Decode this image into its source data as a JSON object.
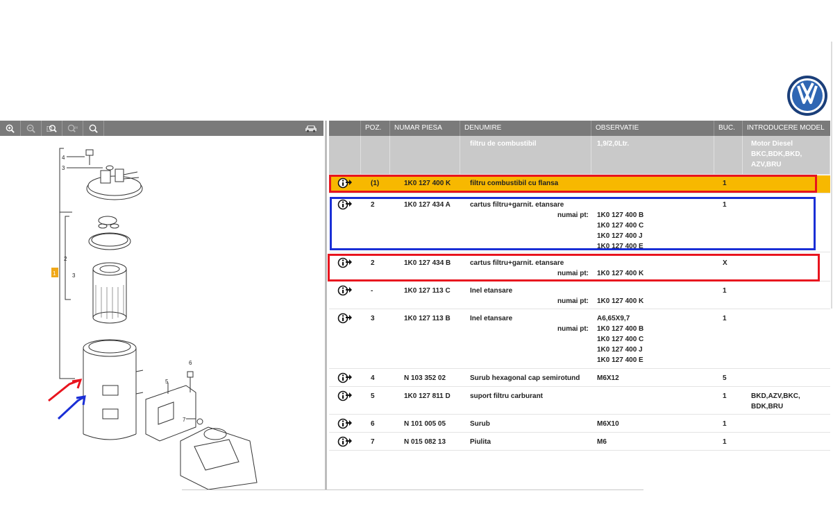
{
  "brand": {
    "logo_icon": "vw-logo-icon"
  },
  "toolbar": {
    "buttons": [
      "zoom-in-icon",
      "zoom-out-icon",
      "zoom-window-icon",
      "zoom-100-icon",
      "search-icon"
    ],
    "car_icon": "car-icon"
  },
  "diagram": {
    "callouts": [
      "4",
      "3",
      "2",
      "3",
      "1",
      "6",
      "5",
      "7"
    ]
  },
  "table": {
    "headers": [
      "",
      "POZ.",
      "NUMAR PIESA",
      "DENUMIRE",
      "OBSERVATIE",
      "BUC.",
      "INTRODUCERE MODEL"
    ],
    "info": {
      "denumire": "filtru de combustibil",
      "observatie": "1,9/2,0Ltr.",
      "introducere": "Motor Diesel BKC,BDK,BKD, AZV,BRU"
    },
    "rows": [
      {
        "poz": "(1)",
        "nr": "1K0 127 400 K",
        "den": "filtru combustibil cu flansa",
        "sub": "",
        "obs": [],
        "buc": "1",
        "intr": ""
      },
      {
        "poz": "2",
        "nr": "1K0 127 434 A",
        "den": "cartus filtru+garnit. etansare",
        "sub": "numai pt:",
        "obs": [
          "1K0 127 400 B",
          "1K0 127 400 C",
          "1K0 127 400 J",
          "1K0 127 400 E"
        ],
        "buc": "1",
        "intr": ""
      },
      {
        "poz": "2",
        "nr": "1K0 127 434 B",
        "den": "cartus filtru+garnit. etansare",
        "sub": "numai pt:",
        "obs": [
          "1K0 127 400 K"
        ],
        "buc": "X",
        "intr": ""
      },
      {
        "poz": "-",
        "nr": "1K0 127 113 C",
        "den": "Inel etansare",
        "sub": "numai pt:",
        "obs": [
          "1K0 127 400 K"
        ],
        "buc": "1",
        "intr": ""
      },
      {
        "poz": "3",
        "nr": "1K0 127 113 B",
        "den": "Inel etansare",
        "sub": "numai pt:",
        "obs": [
          "A6,65X9,7",
          "1K0 127 400 B",
          "1K0 127 400 C",
          "1K0 127 400 J",
          "1K0 127 400 E"
        ],
        "buc": "1",
        "intr": ""
      },
      {
        "poz": "4",
        "nr": "N  103 352 02",
        "den": "Surub hexagonal cap semirotund",
        "sub": "",
        "obs": [
          "M6X12"
        ],
        "buc": "5",
        "intr": ""
      },
      {
        "poz": "5",
        "nr": "1K0 127 811 D",
        "den": "suport filtru carburant",
        "sub": "",
        "obs": [],
        "buc": "1",
        "intr": "BKD,AZV,BKC, BDK,BRU"
      },
      {
        "poz": "6",
        "nr": "N  101 005 05",
        "den": "Surub",
        "sub": "",
        "obs": [
          "M6X10"
        ],
        "buc": "1",
        "intr": ""
      },
      {
        "poz": "7",
        "nr": "N  015 082 13",
        "den": "Piulita",
        "sub": "",
        "obs": [
          "M6"
        ],
        "buc": "1",
        "intr": ""
      }
    ]
  },
  "annotations": {
    "red": "#e8141e",
    "blue": "#1a2fd6",
    "highlight": "#f7b800"
  }
}
